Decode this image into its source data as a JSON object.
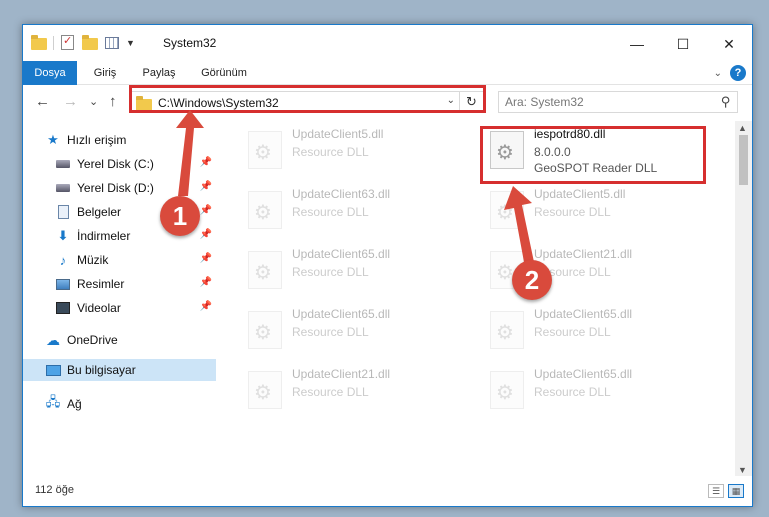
{
  "window": {
    "title": "System32"
  },
  "window_controls": {
    "minimize": "—",
    "maximize": "☐",
    "close": "✕"
  },
  "ribbon": {
    "tabs": [
      {
        "label": "Dosya",
        "active": true
      },
      {
        "label": "Giriş",
        "active": false
      },
      {
        "label": "Paylaş",
        "active": false
      },
      {
        "label": "Görünüm",
        "active": false
      }
    ],
    "help": "?"
  },
  "nav": {
    "back": "←",
    "forward": "→",
    "recent": "⌄",
    "up": "↑"
  },
  "address": {
    "path": "C:\\Windows\\System32"
  },
  "search": {
    "placeholder": "Ara: System32"
  },
  "sidebar": {
    "items": [
      {
        "label": "Hızlı erişim",
        "icon": "star-icon",
        "pinned": false
      },
      {
        "label": "Yerel Disk (C:)",
        "icon": "disk-icon",
        "pinned": true
      },
      {
        "label": "Yerel Disk (D:)",
        "icon": "disk-icon",
        "pinned": true
      },
      {
        "label": "Belgeler",
        "icon": "documents-icon",
        "pinned": true
      },
      {
        "label": "İndirmeler",
        "icon": "download-icon",
        "pinned": true
      },
      {
        "label": "Müzik",
        "icon": "music-icon",
        "pinned": true
      },
      {
        "label": "Resimler",
        "icon": "pictures-icon",
        "pinned": true
      },
      {
        "label": "Videolar",
        "icon": "videos-icon",
        "pinned": true
      },
      {
        "label": "OneDrive",
        "icon": "cloud-icon",
        "pinned": false
      },
      {
        "label": "Bu bilgisayar",
        "icon": "computer-icon",
        "pinned": false,
        "selected": true
      },
      {
        "label": "Ağ",
        "icon": "network-icon",
        "pinned": false
      }
    ]
  },
  "files": {
    "left": [
      {
        "name": "UpdateClient5.dll",
        "type": "Resource DLL"
      },
      {
        "name": "UpdateClient63.dll",
        "type": "Resource DLL"
      },
      {
        "name": "UpdateClient65.dll",
        "type": "Resource DLL"
      },
      {
        "name": "UpdateClient65.dll",
        "type": "Resource DLL"
      },
      {
        "name": "UpdateClient21.dll",
        "type": "Resource DLL"
      }
    ],
    "highlighted": {
      "name": "iespotrd80.dll",
      "version": "8.0.0.0",
      "type": "GeoSPOT Reader DLL"
    },
    "right": [
      {
        "name": "UpdateClient5.dll",
        "type": "Resource DLL"
      },
      {
        "name": "UpdateClient21.dll",
        "type": "Resource DLL"
      },
      {
        "name": "UpdateClient65.dll",
        "type": "Resource DLL"
      },
      {
        "name": "UpdateClient65.dll",
        "type": "Resource DLL"
      }
    ]
  },
  "status": {
    "count": "112 öğe"
  },
  "annotations": {
    "step1": "1",
    "step2": "2",
    "color": "#d94a3c",
    "highlight_color": "#d62f2f"
  }
}
